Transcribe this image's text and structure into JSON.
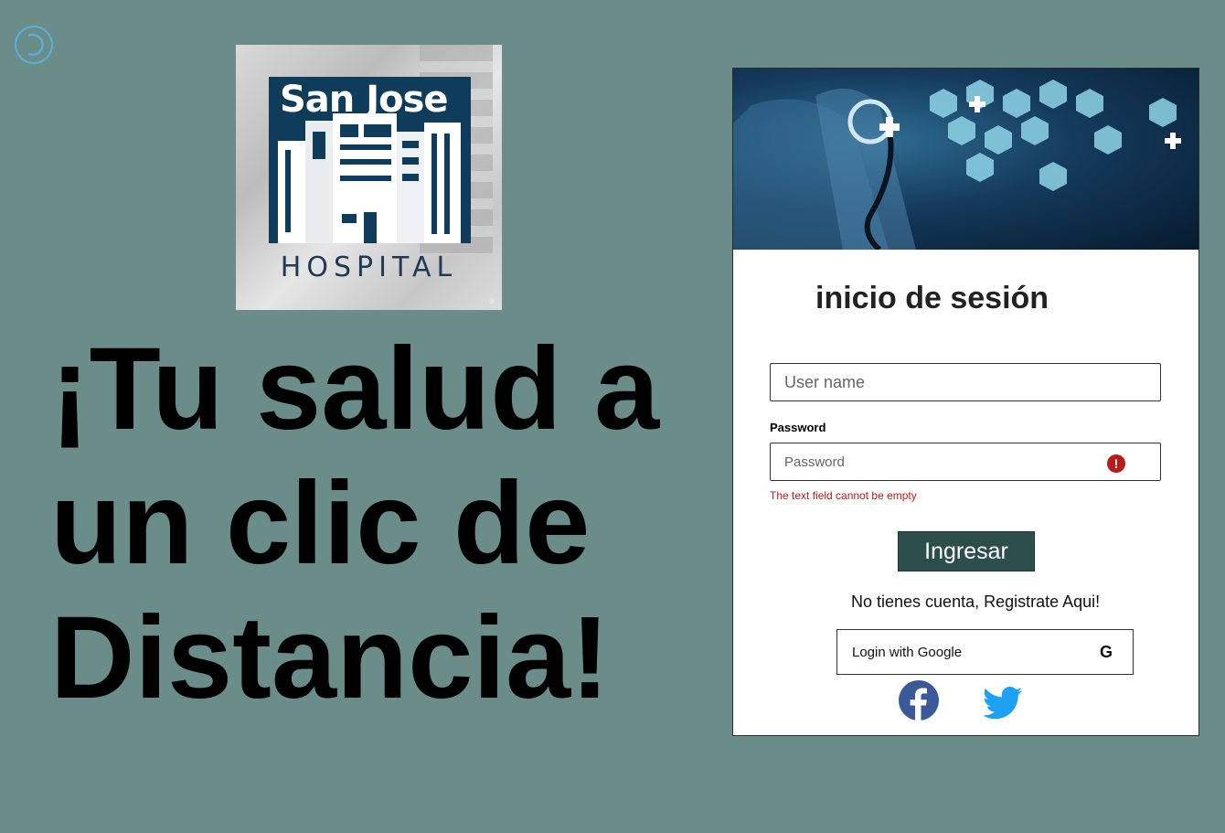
{
  "logo": {
    "brand": "San Jose",
    "subtitle": "HOSPITAL"
  },
  "headline": {
    "lines": [
      "¡Tu salud a",
      "un clic de",
      "Distancia!"
    ]
  },
  "login": {
    "title": "inicio de sesión",
    "username_placeholder": "User name",
    "password_label": "Password",
    "password_placeholder": "Password",
    "error_text": "The text field cannot be empty",
    "submit_label": "Ingresar",
    "register_text": "No tienes cuenta, Registrate Aqui!",
    "google_label": "Login with Google",
    "google_icon_glyph": "G"
  },
  "colors": {
    "background": "#6b8d89",
    "button": "#2c4f4c",
    "error": "#b71c1c",
    "facebook": "#3b5998",
    "twitter": "#1da1f2"
  }
}
